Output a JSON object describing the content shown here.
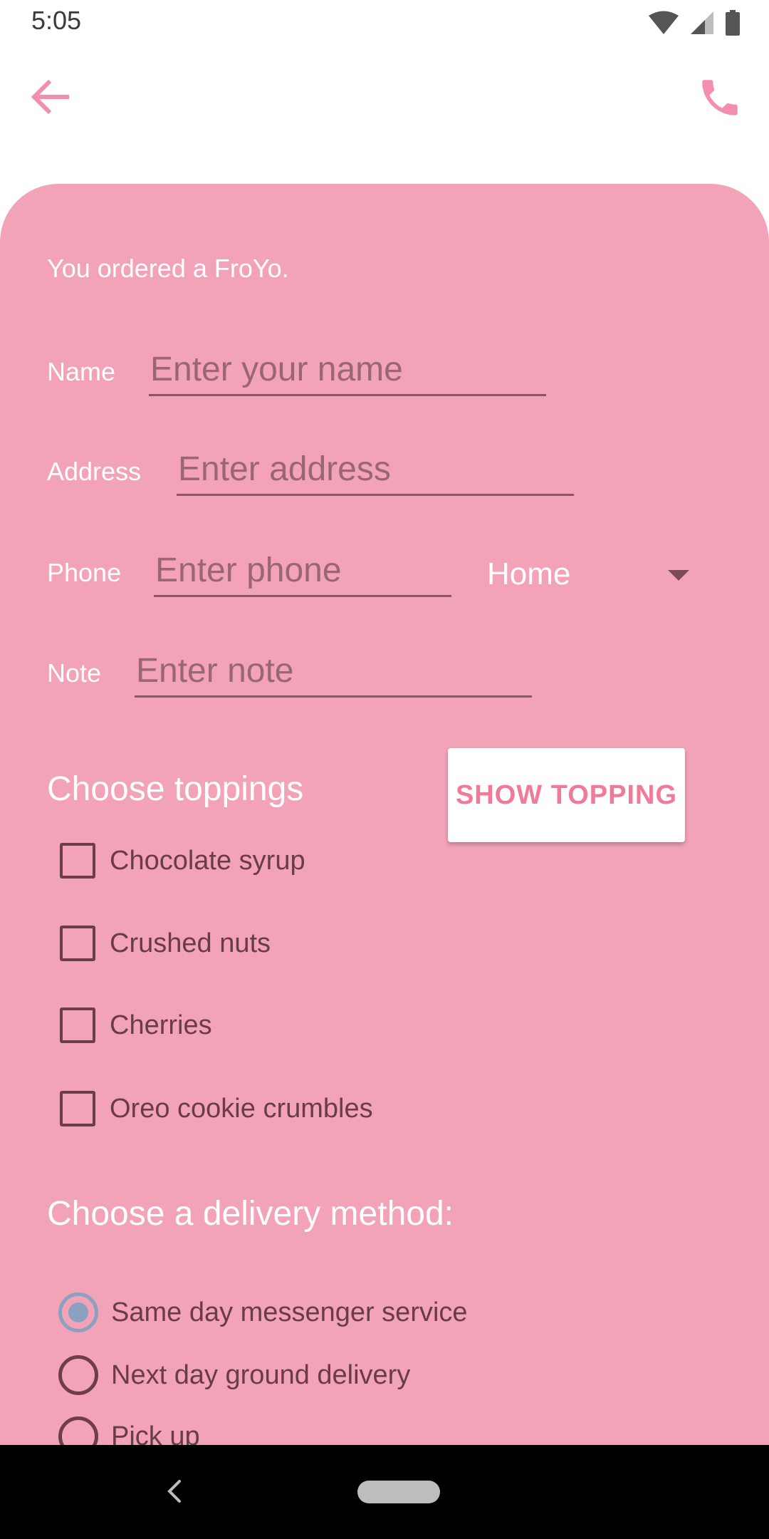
{
  "status_bar": {
    "time": "5:05",
    "icons": [
      "wifi-icon",
      "signal-icon",
      "battery-icon"
    ]
  },
  "app_bar": {
    "back_icon": "arrow-left-icon",
    "action_icon": "phone-icon",
    "accent_color": "#f38fae"
  },
  "form": {
    "background_color": "#f3a3b7",
    "order_message": "You ordered a FroYo.",
    "name": {
      "label": "Name",
      "placeholder": "Enter your name",
      "value": ""
    },
    "address": {
      "label": "Address",
      "placeholder": "Enter address",
      "value": ""
    },
    "phone": {
      "label": "Phone",
      "placeholder": "Enter phone",
      "value": "",
      "type_selected": "Home"
    },
    "note": {
      "label": "Note",
      "placeholder": "Enter note",
      "value": ""
    }
  },
  "toppings": {
    "title": "Choose toppings",
    "button_label": "SHOW TOPPING",
    "items": [
      {
        "label": "Chocolate syrup",
        "checked": false
      },
      {
        "label": "Crushed nuts",
        "checked": false
      },
      {
        "label": "Cherries",
        "checked": false
      },
      {
        "label": "Oreo cookie crumbles",
        "checked": false
      }
    ]
  },
  "delivery": {
    "title": "Choose a delivery method:",
    "options": [
      {
        "label": "Same day messenger service",
        "selected": true
      },
      {
        "label": "Next day ground delivery",
        "selected": false
      },
      {
        "label": "Pick up",
        "selected": false
      }
    ]
  },
  "nav_bar": {
    "back_icon": "nav-back-icon",
    "home_icon": "nav-home-pill"
  }
}
